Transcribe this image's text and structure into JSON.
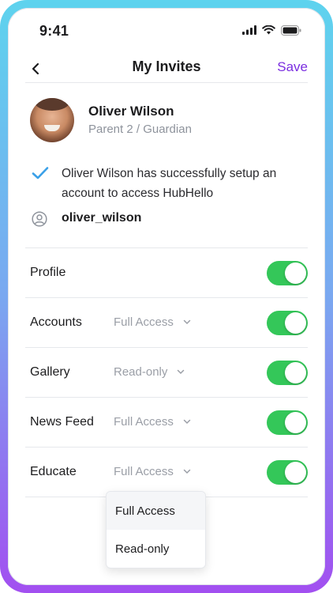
{
  "status_bar": {
    "time": "9:41"
  },
  "nav": {
    "title": "My Invites",
    "save_label": "Save"
  },
  "profile": {
    "name": "Oliver Wilson",
    "role": "Parent 2 / Guardian",
    "success_message": "Oliver Wilson has successfully setup an account to access HubHello",
    "username": "oliver_wilson"
  },
  "permissions": [
    {
      "label": "Profile",
      "access": "",
      "enabled": true
    },
    {
      "label": "Accounts",
      "access": "Full Access",
      "enabled": true
    },
    {
      "label": "Gallery",
      "access": "Read-only",
      "enabled": true
    },
    {
      "label": "News Feed",
      "access": "Full Access",
      "enabled": true
    },
    {
      "label": "Educate",
      "access": "Full Access",
      "enabled": true
    }
  ],
  "dropdown": {
    "options": [
      "Full Access",
      "Read-only"
    ],
    "highlighted": "Full Access"
  },
  "colors": {
    "accent": "#7b2ee0",
    "toggle_on": "#34c759",
    "check": "#3aa0e8",
    "muted_text": "#9a9ea6"
  }
}
